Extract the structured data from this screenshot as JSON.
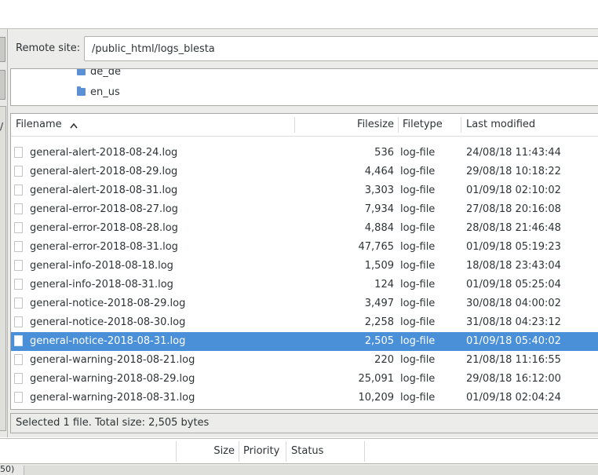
{
  "remote_site": {
    "label": "Remote site:",
    "path": "/public_html/logs_blesta"
  },
  "tree": {
    "items": [
      "de_de",
      "en_us"
    ]
  },
  "list": {
    "headers": {
      "filename": "Filename",
      "sort_indicator": "^",
      "filesize": "Filesize",
      "filetype": "Filetype",
      "last_modified": "Last modified"
    },
    "rows": [
      {
        "name": "general-alert-2018-08-24.log",
        "size": "536",
        "type": "log-file",
        "modified": "24/08/18 11:43:44"
      },
      {
        "name": "general-alert-2018-08-29.log",
        "size": "4,464",
        "type": "log-file",
        "modified": "29/08/18 10:18:22"
      },
      {
        "name": "general-alert-2018-08-31.log",
        "size": "3,303",
        "type": "log-file",
        "modified": "01/09/18 02:10:02"
      },
      {
        "name": "general-error-2018-08-27.log",
        "size": "7,934",
        "type": "log-file",
        "modified": "27/08/18 20:16:08"
      },
      {
        "name": "general-error-2018-08-28.log",
        "size": "4,884",
        "type": "log-file",
        "modified": "28/08/18 21:46:48"
      },
      {
        "name": "general-error-2018-08-31.log",
        "size": "47,765",
        "type": "log-file",
        "modified": "01/09/18 05:19:23"
      },
      {
        "name": "general-info-2018-08-18.log",
        "size": "1,509",
        "type": "log-file",
        "modified": "18/08/18 23:43:04"
      },
      {
        "name": "general-info-2018-08-31.log",
        "size": "124",
        "type": "log-file",
        "modified": "01/09/18 05:25:04"
      },
      {
        "name": "general-notice-2018-08-29.log",
        "size": "3,497",
        "type": "log-file",
        "modified": "30/08/18 04:00:02"
      },
      {
        "name": "general-notice-2018-08-30.log",
        "size": "2,258",
        "type": "log-file",
        "modified": "31/08/18 04:23:12"
      },
      {
        "name": "general-notice-2018-08-31.log",
        "size": "2,505",
        "type": "log-file",
        "modified": "01/09/18 05:40:02",
        "selected": true
      },
      {
        "name": "general-warning-2018-08-21.log",
        "size": "220",
        "type": "log-file",
        "modified": "21/08/18 11:16:55"
      },
      {
        "name": "general-warning-2018-08-29.log",
        "size": "25,091",
        "type": "log-file",
        "modified": "29/08/18 16:12:00"
      },
      {
        "name": "general-warning-2018-08-31.log",
        "size": "10,209",
        "type": "log-file",
        "modified": "01/09/18 02:04:24"
      }
    ]
  },
  "status": {
    "text": "Selected 1 file. Total size: 2,505 bytes"
  },
  "queue": {
    "headers": {
      "size": "Size",
      "priority": "Priority",
      "status": "Status"
    }
  },
  "left_pane": {
    "cut_label": "/"
  },
  "bottom": {
    "cut_label": "50)"
  },
  "colors": {
    "selection": "#4a90d9",
    "folder": "#5b8fd6"
  }
}
